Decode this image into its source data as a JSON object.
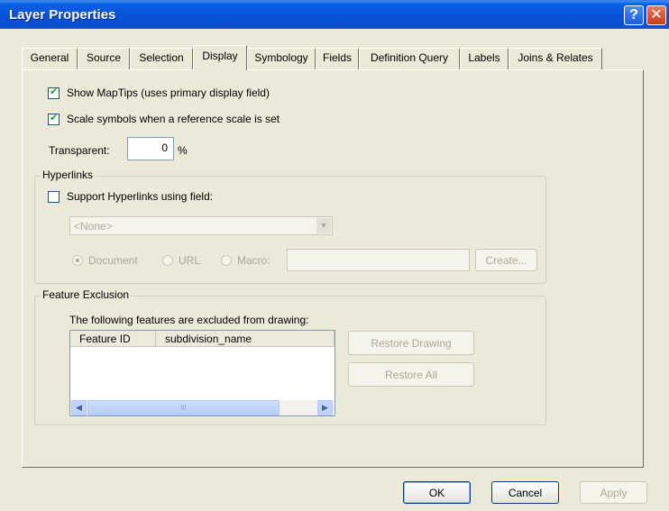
{
  "window": {
    "title": "Layer Properties",
    "help_glyph": "?",
    "close_glyph": "✕"
  },
  "tabs": [
    {
      "label": "General"
    },
    {
      "label": "Source"
    },
    {
      "label": "Selection"
    },
    {
      "label": "Display"
    },
    {
      "label": "Symbology"
    },
    {
      "label": "Fields"
    },
    {
      "label": "Definition Query"
    },
    {
      "label": "Labels"
    },
    {
      "label": "Joins & Relates"
    }
  ],
  "active_tab": "Display",
  "display": {
    "show_maptips": {
      "label": "Show MapTips (uses primary display field)",
      "checked": true
    },
    "scale_symbols": {
      "label": "Scale symbols when a reference scale is set",
      "checked": true
    },
    "transparent": {
      "label": "Transparent:",
      "value": "0",
      "unit": "%"
    }
  },
  "hyperlinks": {
    "legend": "Hyperlinks",
    "support": {
      "label": "Support Hyperlinks using field:",
      "checked": false
    },
    "field_value": "<None>",
    "document_label": "Document",
    "url_label": "URL",
    "macro_label": "Macro:",
    "macro_value": "",
    "create_label": "Create..."
  },
  "feature_exclusion": {
    "legend": "Feature Exclusion",
    "caption": "The following features are excluded from drawing:",
    "columns": [
      "Feature ID",
      "subdivision_name"
    ],
    "rows": [],
    "restore_drawing_label": "Restore Drawing",
    "restore_all_label": "Restore All",
    "scroll_grip": "III"
  },
  "footer": {
    "ok_label": "OK",
    "cancel_label": "Cancel",
    "apply_label": "Apply"
  }
}
